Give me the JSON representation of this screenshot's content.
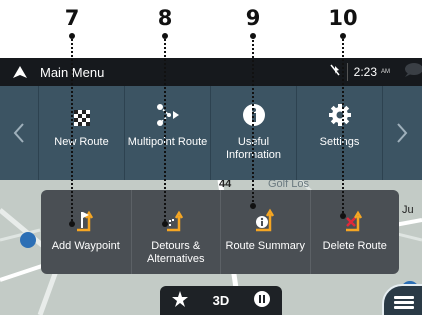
{
  "callouts": [
    "7",
    "8",
    "9",
    "10"
  ],
  "statusbar": {
    "title": "Main Menu",
    "time": "2:23",
    "ampm": "AM",
    "nav_icon": "navigation-arrow-icon",
    "gps_icon": "gps-off-icon",
    "message_icon": "message-bubble-icon"
  },
  "main_menu": {
    "items": [
      {
        "label": "New Route",
        "icon": "checkered-flag-icon"
      },
      {
        "label": "Multipoint Route",
        "icon": "multipoint-route-icon"
      },
      {
        "label": "Useful Information",
        "icon": "info-icon"
      },
      {
        "label": "Settings",
        "icon": "gear-icon"
      }
    ],
    "page_index": 1,
    "page_count": 2
  },
  "sub_menu": {
    "items": [
      {
        "label": "Add Waypoint",
        "icon": "add-waypoint-icon"
      },
      {
        "label": "Detours & Alternatives",
        "icon": "detours-icon"
      },
      {
        "label": "Route Summary",
        "icon": "route-summary-icon"
      },
      {
        "label": "Delete Route",
        "icon": "delete-route-icon"
      }
    ]
  },
  "map": {
    "road_number": "44",
    "place_label": "Golf Los",
    "edge_label": "Ju"
  },
  "bottom_bar": {
    "view_mode": "3D",
    "favorite_icon": "star-icon",
    "pause_icon": "pause-icon"
  },
  "colors": {
    "accent": "#f5a623",
    "menu_bg": "#3c5463",
    "submenu_bg": "#4a4f54",
    "statusbar_bg": "#16191d"
  }
}
